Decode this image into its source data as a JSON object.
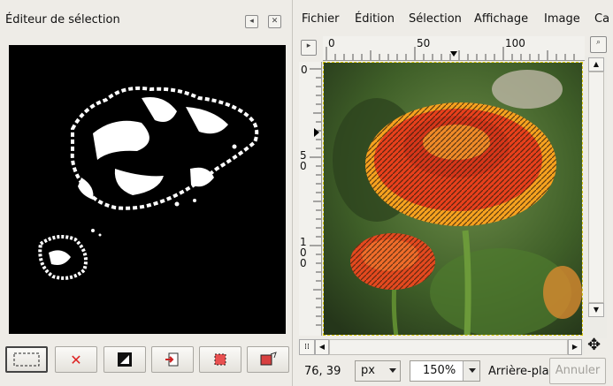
{
  "left_panel": {
    "title": "Éditeur de sélection",
    "toolbar_icons": [
      "select-all-icon",
      "select-none-icon",
      "invert-selection-icon",
      "save-to-channel-icon",
      "to-path-icon",
      "stroke-selection-icon"
    ]
  },
  "menu": {
    "items": [
      {
        "label": "Fichier"
      },
      {
        "label": "Édition"
      },
      {
        "label": "Sélection"
      },
      {
        "label": "Affichage"
      },
      {
        "label": "Image"
      },
      {
        "label": "Ca"
      }
    ]
  },
  "ruler": {
    "top_labels": [
      "0",
      "50",
      "100"
    ],
    "left_labels": [
      "0",
      "50",
      "100"
    ]
  },
  "status": {
    "coords": "76, 39",
    "unit": "px",
    "zoom": "150%",
    "layer": "Arrière-pla",
    "cancel": "Annuler"
  },
  "colors": {
    "selection_marching_ants": "#d4c400",
    "flower_primary": "#e8401c",
    "flower_secondary": "#f7a21f",
    "foliage": "#3a5a24"
  }
}
